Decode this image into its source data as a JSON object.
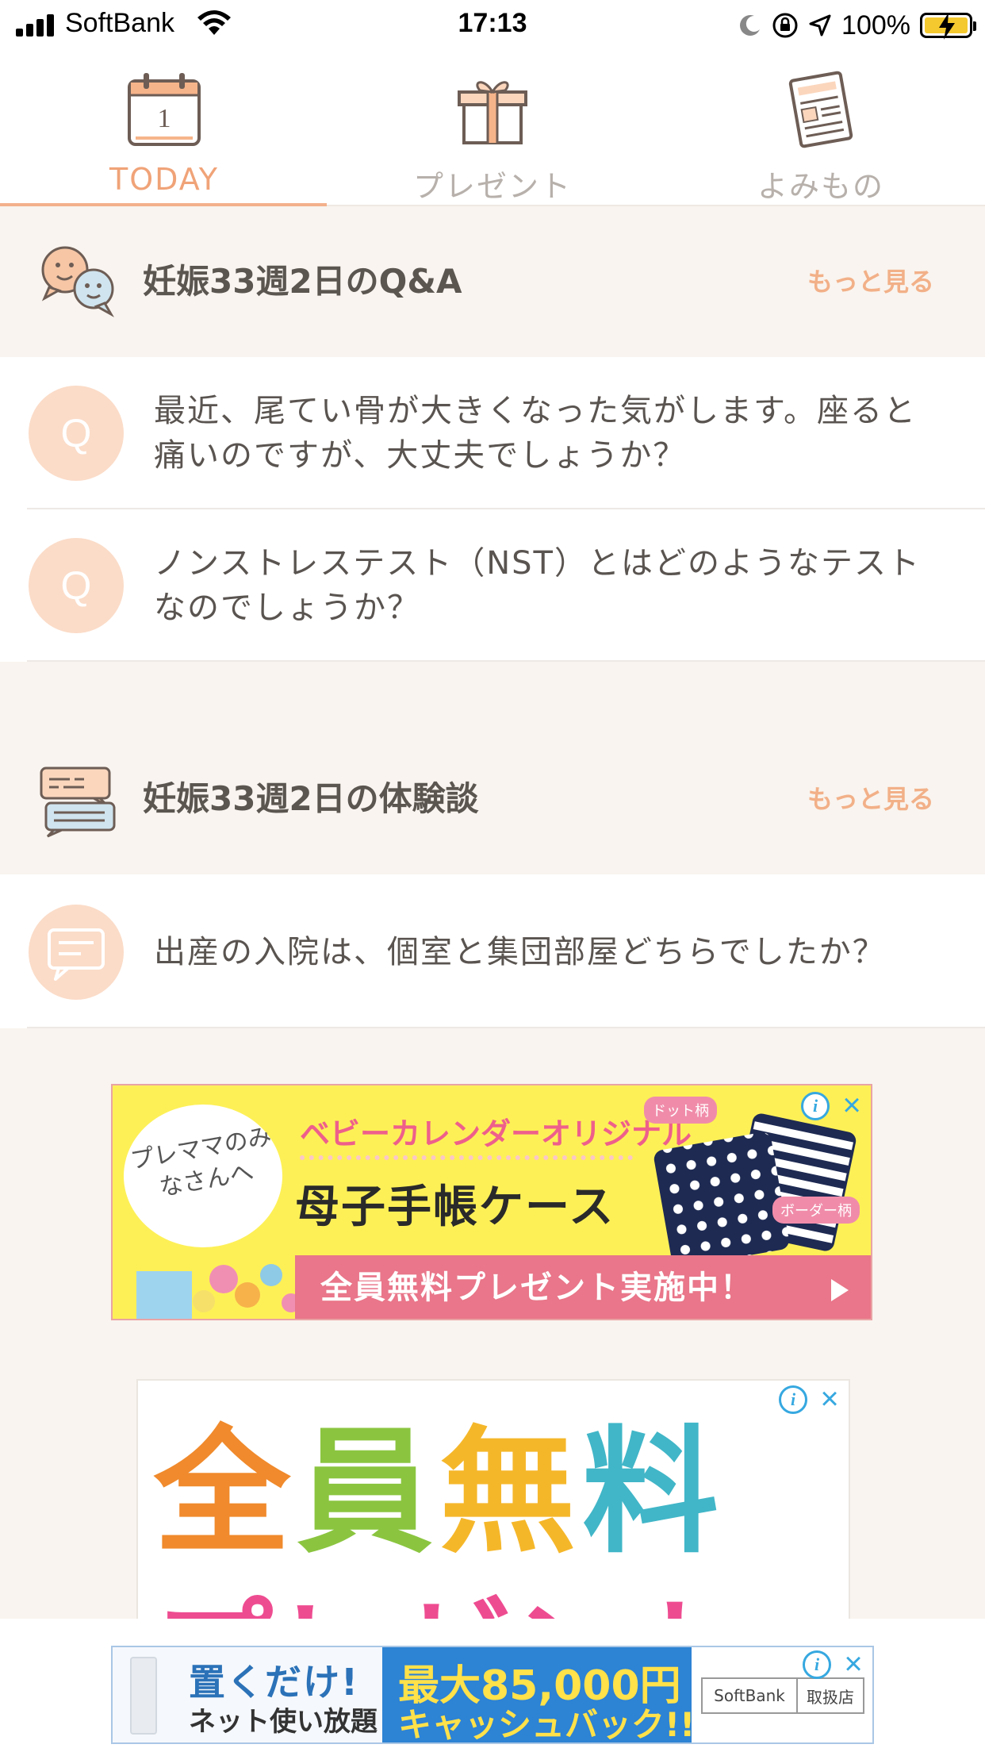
{
  "status_bar": {
    "carrier": "SoftBank",
    "time": "17:13",
    "battery_percent": "100%"
  },
  "tabs": [
    {
      "label": "TODAY",
      "icon": "calendar-icon",
      "calendar_day": "1",
      "active": true
    },
    {
      "label": "プレゼント",
      "icon": "gift-icon",
      "active": false
    },
    {
      "label": "よみもの",
      "icon": "newspaper-icon",
      "active": false
    }
  ],
  "qa_section": {
    "title": "妊娠33週2日のQ&A",
    "more_label": "もっと見る",
    "icon": "chat-faces-icon",
    "items": [
      {
        "badge": "Q",
        "text": "最近、尾てい骨が大きくなった気がします。座ると痛いのですが、大丈夫でしょうか？"
      },
      {
        "badge": "Q",
        "text": "ノンストレステスト（NST）とはどのようなテストなのでしょうか？"
      }
    ]
  },
  "experience_section": {
    "title": "妊娠33週2日の体験談",
    "more_label": "もっと見る",
    "icon": "speech-bubbles-icon",
    "items": [
      {
        "icon": "comment-icon",
        "text": "出産の入院は、個室と集団部屋どちらでしたか？"
      }
    ]
  },
  "ads": {
    "ad1": {
      "bubble_text": "プレママのみなさんへ",
      "brand": "ベビーカレンダーオリジナル",
      "headline": "母子手帳ケース",
      "cta": "全員無料プレゼント実施中！",
      "tag_dots": "ドット柄",
      "tag_border": "ボーダー柄"
    },
    "ad2": {
      "chars": [
        "全",
        "員",
        "無",
        "料"
      ],
      "pink_text": "プレゼント"
    },
    "ad3": {
      "line1": "置くだけ!",
      "line2": "ネット使い放題",
      "max_line": "最大85,000円",
      "cashback": "キャッシュバック!!",
      "logo_brand": "SoftBank",
      "logo_store": "取扱店"
    }
  },
  "colors": {
    "accent": "#f0a378",
    "section_bg": "#f9f4ef",
    "badge_bg": "#fbdcc8",
    "ad_choice": "#36a8e0"
  }
}
